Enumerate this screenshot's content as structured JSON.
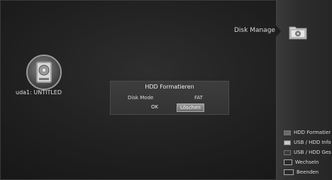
{
  "header": {
    "title": "Disk Manage",
    "icon": "folder-icon"
  },
  "disk": {
    "label": "uda1: UNTITLED",
    "icon": "hdd-icon"
  },
  "dialog": {
    "title": "HDD Formatieren",
    "mode_label": "Disk Mode",
    "mode_value": "FAT",
    "ok_label": "OK",
    "delete_label": "Löschen"
  },
  "menu": {
    "items": [
      {
        "label": "HDD Formatier",
        "key": "red-key-icon"
      },
      {
        "label": "USB / HDD Info",
        "key": "green-key-icon"
      },
      {
        "label": "USB / HDD Ges",
        "key": "yellow-key-icon"
      },
      {
        "label": "Wechseln",
        "key": "blue-key-icon"
      },
      {
        "label": "Beenden",
        "key": "exit-key-icon"
      }
    ]
  },
  "colors": {
    "panel": "#2d2d2d",
    "dialog": "#363636",
    "button_active": "#8a8a8a"
  }
}
